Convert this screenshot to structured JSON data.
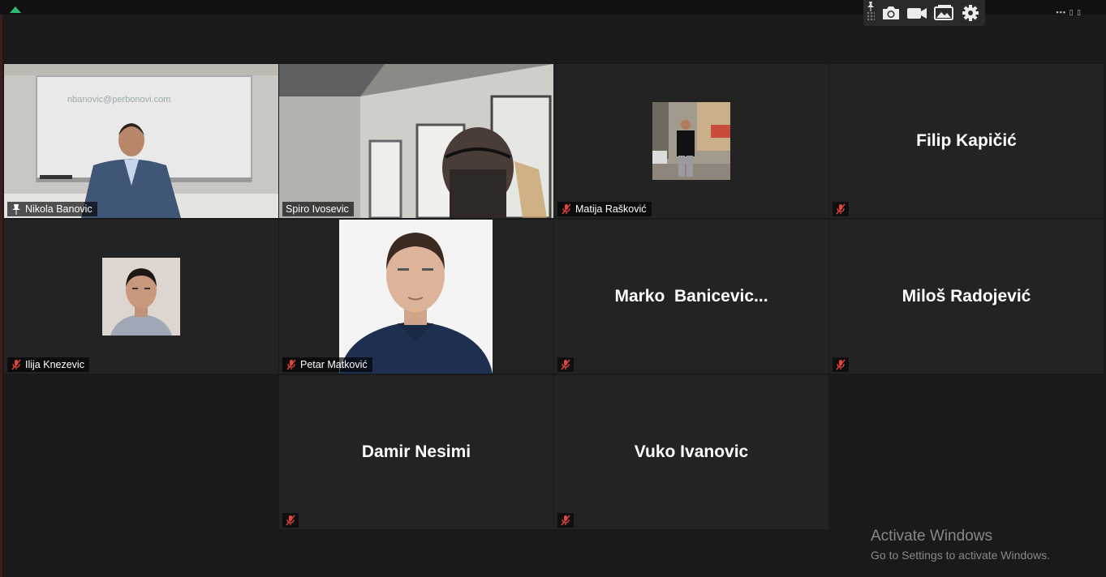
{
  "toolbar": {
    "items": [
      "pin-icon",
      "camera-icon",
      "video-icon",
      "share-screen-icon",
      "settings-icon"
    ]
  },
  "participants": [
    {
      "name": "Nikola Banovic",
      "pinned": true,
      "video": true
    },
    {
      "name": "Spiro Ivosevic",
      "video": true
    },
    {
      "name": "Matija Rašković",
      "muted": true,
      "photo": true
    },
    {
      "display_name": "Filip Kapičić",
      "muted": true
    },
    {
      "name": "Ilija Knezevic",
      "muted": true,
      "photo": true
    },
    {
      "name": "Petar Matković",
      "muted": true,
      "photo": true
    },
    {
      "display_name": "Marko  Banicevic...",
      "muted": true
    },
    {
      "display_name": "Miloš Radojević",
      "muted": true
    },
    {
      "display_name": "Damir Nesimi",
      "muted": true
    },
    {
      "display_name": "Vuko Ivanovic",
      "muted": true
    }
  ],
  "whiteboard_text": "nbanovic@perbonovi.com",
  "watermark": {
    "title": "Activate Windows",
    "subtitle": "Go to Settings to activate Windows."
  },
  "colors": {
    "active_speaker_border": "#d5e07a",
    "mute_icon": "#e0463e",
    "tile_bg": "#232323"
  }
}
